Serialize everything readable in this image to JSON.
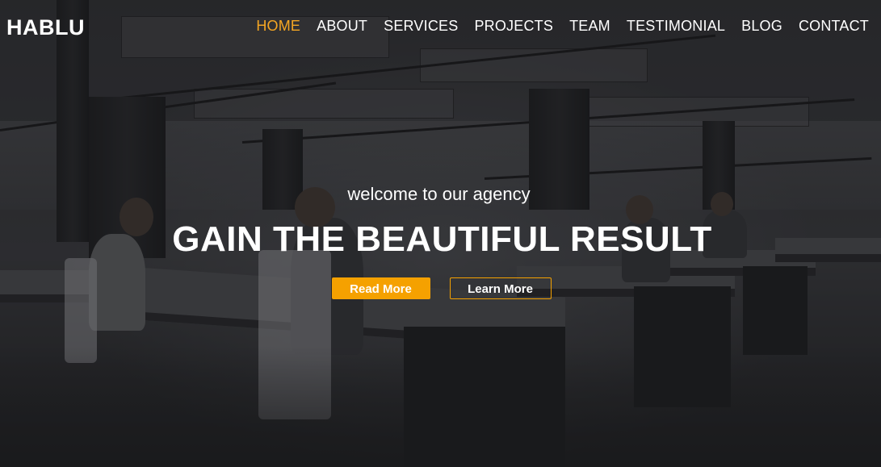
{
  "brand": {
    "logo": "HABLU"
  },
  "nav": {
    "items": [
      {
        "label": "HOME",
        "active": true
      },
      {
        "label": "ABOUT",
        "active": false
      },
      {
        "label": "SERVICES",
        "active": false
      },
      {
        "label": "PROJECTS",
        "active": false
      },
      {
        "label": "TEAM",
        "active": false
      },
      {
        "label": "TESTIMONIAL",
        "active": false
      },
      {
        "label": "BLOG",
        "active": false
      },
      {
        "label": "CONTACT",
        "active": false
      }
    ]
  },
  "hero": {
    "tagline": "welcome to our agency",
    "headline": "GAIN THE BEAUTIFUL RESULT",
    "primary_button": "Read More",
    "secondary_button": "Learn More"
  },
  "colors": {
    "accent": "#f5a100",
    "text": "#ffffff",
    "overlay": "#141416"
  }
}
